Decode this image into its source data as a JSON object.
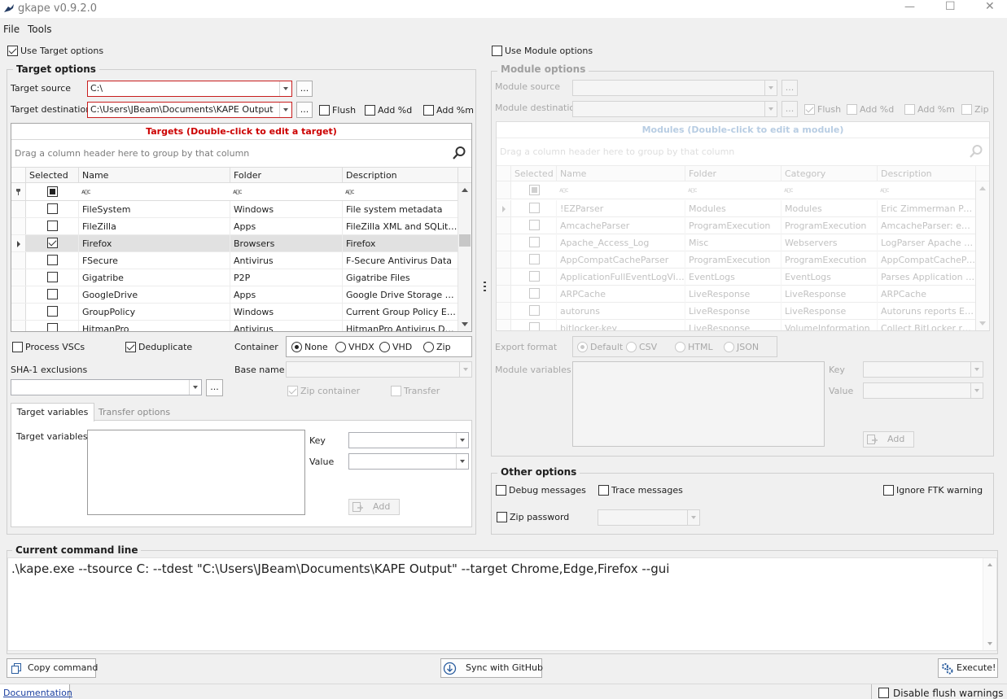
{
  "window": {
    "title": "gkape v0.9.2.0",
    "minimize_glyph": "—",
    "maximize_glyph": "☐",
    "close_glyph": "✕"
  },
  "menu": {
    "file": "File",
    "tools": "Tools"
  },
  "use_target_options": "Use Target options",
  "use_module_options": "Use Module options",
  "target_options": {
    "heading": "Target options",
    "source_label": "Target source",
    "source_value": "C:\\",
    "destination_label": "Target destination",
    "destination_value": "C:\\Users\\JBeam\\Documents\\KAPE Output",
    "browse": "...",
    "flush": "Flush",
    "add_d": "Add %d",
    "add_m": "Add %m",
    "grid": {
      "title": "Targets (Double-click to edit a target)",
      "group_hint": "Drag a column header here to group by that column",
      "columns": [
        "Selected",
        "Name",
        "Folder",
        "Description"
      ],
      "filter_glyph": "ᴀ▯ᴄ",
      "rows": [
        {
          "name": "FileSystem",
          "folder": "Windows",
          "description": "File system metadata",
          "selected": false
        },
        {
          "name": "FileZilla",
          "folder": "Apps",
          "description": "FileZilla XML and SQLite Lo...",
          "selected": false
        },
        {
          "name": "Firefox",
          "folder": "Browsers",
          "description": "Firefox",
          "selected": true
        },
        {
          "name": "FSecure",
          "folder": "Antivirus",
          "description": "F-Secure Antivirus Data",
          "selected": false
        },
        {
          "name": "Gigatribe",
          "folder": "P2P",
          "description": "Gigatribe Files",
          "selected": false
        },
        {
          "name": "GoogleDrive",
          "folder": "Apps",
          "description": "Google Drive Storage File...",
          "selected": false
        },
        {
          "name": "GroupPolicy",
          "folder": "Windows",
          "description": "Current Group Policy Enfo...",
          "selected": false
        },
        {
          "name": "HitmanPro",
          "folder": "Antivirus",
          "description": "HitmanPro Antivirus Data",
          "selected": false
        }
      ]
    },
    "process_vscs": "Process VSCs",
    "deduplicate": "Deduplicate",
    "container_label": "Container",
    "container_options": [
      "None",
      "VHDX",
      "VHD",
      "Zip"
    ],
    "container_selected": "None",
    "sha1_label": "SHA-1 exclusions",
    "base_name_label": "Base name",
    "zip_container": "Zip container",
    "transfer": "Transfer",
    "tabs": [
      "Target variables",
      "Transfer options"
    ],
    "vars_label": "Target variables",
    "key_label": "Key",
    "value_label": "Value",
    "add": "Add"
  },
  "module_options": {
    "heading": "Module options",
    "source_label": "Module source",
    "destination_label": "Module destination",
    "browse": "...",
    "flush": "Flush",
    "add_d": "Add %d",
    "add_m": "Add %m",
    "zip": "Zip",
    "grid": {
      "title": "Modules (Double-click to edit a module)",
      "group_hint": "Drag a column header here to group by that column",
      "columns": [
        "Selected",
        "Name",
        "Folder",
        "Category",
        "Description"
      ],
      "filter_glyph": "ᴀ▯ᴄ",
      "rows": [
        {
          "name": "!EZParser",
          "folder": "Modules",
          "category": "Modules",
          "description": "Eric Zimmerman Parsers"
        },
        {
          "name": "AmcacheParser",
          "folder": "ProgramExecution",
          "category": "ProgramExecution",
          "description": "AmcacheParser: extr..."
        },
        {
          "name": "Apache_Access_Log",
          "folder": "Misc",
          "category": "Webservers",
          "description": "LogParser Apache Ac..."
        },
        {
          "name": "AppCompatCacheParser",
          "folder": "ProgramExecution",
          "category": "ProgramExecution",
          "description": "AppCompatCachePar..."
        },
        {
          "name": "ApplicationFullEventLogView",
          "folder": "EventLogs",
          "category": "EventLogs",
          "description": "Parses Application ev..."
        },
        {
          "name": "ARPCache",
          "folder": "LiveResponse",
          "category": "LiveResponse",
          "description": "ARPCache"
        },
        {
          "name": "autoruns",
          "folder": "LiveResponse",
          "category": "LiveResponse",
          "description": "Autoruns reports Exp..."
        },
        {
          "name": "bitlocker-key",
          "folder": "LiveResponse",
          "category": "VolumeInformation",
          "description": "Collect BitLocker reco..."
        }
      ]
    },
    "export_label": "Export format",
    "export_options": [
      "Default",
      "CSV",
      "HTML",
      "JSON"
    ],
    "export_selected": "Default",
    "vars_label": "Module variables",
    "key_label": "Key",
    "value_label": "Value",
    "add": "Add"
  },
  "other_options": {
    "heading": "Other options",
    "debug": "Debug messages",
    "trace": "Trace messages",
    "ignore_ftk": "Ignore FTK warning",
    "zip_password": "Zip password"
  },
  "command": {
    "heading": "Current command line",
    "text": ".\\kape.exe --tsource C: --tdest \"C:\\Users\\JBeam\\Documents\\KAPE Output\" --target Chrome,Edge,Firefox --gui"
  },
  "buttons": {
    "copy": "Copy command",
    "sync": "Sync with GitHub",
    "execute": "Execute!"
  },
  "footer": {
    "documentation": "Documentation",
    "disable_flush": "Disable flush warnings"
  }
}
